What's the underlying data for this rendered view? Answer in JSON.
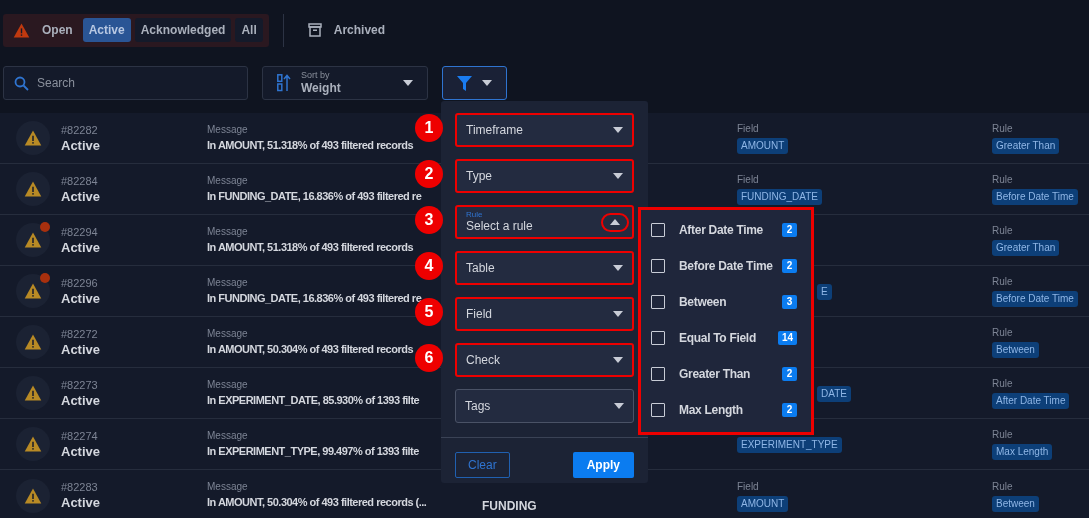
{
  "status_filter": {
    "label": "Open",
    "tabs": [
      {
        "label": "Active",
        "selected": true
      },
      {
        "label": "Acknowledged",
        "selected": false
      },
      {
        "label": "All",
        "selected": false
      }
    ]
  },
  "archived": {
    "label": "Archived"
  },
  "search": {
    "placeholder": "Search"
  },
  "sort": {
    "label": "Sort by",
    "value": "Weight"
  },
  "alerts": [
    {
      "id": "#82282",
      "status": "Active",
      "unread": false,
      "message_label": "Message",
      "message": "In AMOUNT, 51.318% of 493 filtered records",
      "field_label": "Field",
      "field": "AMOUNT",
      "rule_label": "Rule",
      "rule": "Greater Than"
    },
    {
      "id": "#82284",
      "status": "Active",
      "unread": false,
      "message_label": "Message",
      "message": "In FUNDING_DATE, 16.836% of 493 filtered re",
      "field_label": "Field",
      "field": "FUNDING_DATE",
      "rule_label": "Rule",
      "rule": "Before Date Time"
    },
    {
      "id": "#82294",
      "status": "Active",
      "unread": true,
      "message_label": "Message",
      "message": "In AMOUNT, 51.318% of 493 filtered records",
      "rule_label": "Rule",
      "rule": "Greater Than"
    },
    {
      "id": "#82296",
      "status": "Active",
      "unread": true,
      "message_label": "Message",
      "message": "In FUNDING_DATE, 16.836% of 493 filtered re",
      "field": "E",
      "rule_label": "Rule",
      "rule": "Before Date Time"
    },
    {
      "id": "#82272",
      "status": "Active",
      "unread": false,
      "message_label": "Message",
      "message": "In AMOUNT, 50.304% of 493 filtered records",
      "rule_label": "Rule",
      "rule": "Between"
    },
    {
      "id": "#82273",
      "status": "Active",
      "unread": false,
      "message_label": "Message",
      "message": "In EXPERIMENT_DATE, 85.930% of 1393 filte",
      "field": "DATE",
      "rule_label": "Rule",
      "rule": "After Date Time"
    },
    {
      "id": "#82274",
      "status": "Active",
      "unread": false,
      "message_label": "Message",
      "message": "In EXPERIMENT_TYPE, 99.497% of 1393 filte",
      "field": "EXPERIMENT_TYPE",
      "rule_label": "Rule",
      "rule": "Max Length"
    },
    {
      "id": "#82283",
      "status": "Active",
      "unread": false,
      "message_label": "Message",
      "message": "In AMOUNT, 50.304% of 493 filtered records (...",
      "column_3": "FUNDING",
      "field_label": "Field",
      "field": "AMOUNT",
      "rule_label": "Rule",
      "rule": "Between"
    }
  ],
  "filter_panel": {
    "selects": [
      {
        "kind": "select",
        "label": "Timeframe",
        "step": "1"
      },
      {
        "kind": "select",
        "label": "Type",
        "step": "2"
      },
      {
        "kind": "rule",
        "label": "Rule",
        "placeholder": "Select a rule",
        "step": "3",
        "expanded": true
      },
      {
        "kind": "select",
        "label": "Table",
        "step": "4"
      },
      {
        "kind": "select",
        "label": "Field",
        "step": "5"
      },
      {
        "kind": "select",
        "label": "Check",
        "step": "6"
      },
      {
        "kind": "select",
        "label": "Tags"
      }
    ],
    "rule_options": [
      {
        "label": "After Date Time",
        "count": "2",
        "checked": false
      },
      {
        "label": "Before Date Time",
        "count": "2",
        "checked": false
      },
      {
        "label": "Between",
        "count": "3",
        "checked": false
      },
      {
        "label": "Equal To Field",
        "count": "14",
        "checked": false
      },
      {
        "label": "Greater Than",
        "count": "2",
        "checked": false
      },
      {
        "label": "Max Length",
        "count": "2",
        "checked": false
      }
    ],
    "clear": "Clear",
    "apply": "Apply"
  }
}
